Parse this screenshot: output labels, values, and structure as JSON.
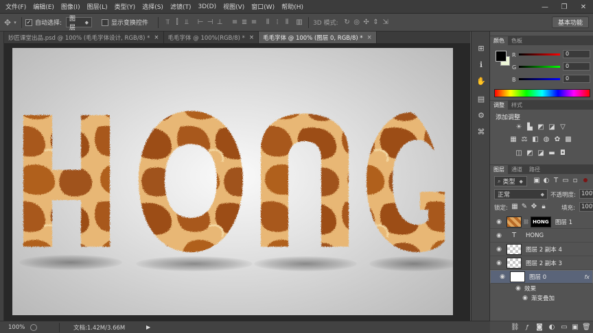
{
  "menu": [
    "文件(F)",
    "编辑(E)",
    "图像(I)",
    "图层(L)",
    "类型(Y)",
    "选择(S)",
    "滤镜(T)",
    "3D(D)",
    "视图(V)",
    "窗口(W)",
    "帮助(H)"
  ],
  "window_controls": {
    "minimize": "—",
    "restore": "❐",
    "close": "✕"
  },
  "options": {
    "auto_select_label": "自动选择:",
    "auto_select_value": "图层",
    "show_transform_label": "显示变换控件",
    "mode_3d_label": "3D 模式:",
    "workspace_button": "基本功能"
  },
  "tabs": [
    {
      "label": "妙匠课堂出品.psd @ 100% (毛毛字体设计, RGB/8) *",
      "close": "×",
      "active": false
    },
    {
      "label": "毛毛字体 @ 100%(RGB/8) *",
      "close": "×",
      "active": false
    },
    {
      "label": "毛毛字体 @ 100% (图层 0, RGB/8) *",
      "close": "×",
      "active": true
    }
  ],
  "canvas": {
    "letters": [
      "H",
      "O",
      "N",
      "G"
    ]
  },
  "status": {
    "zoom": "100%",
    "doc_info": "文档:1.42M/3.66M"
  },
  "color_panel": {
    "tabs": [
      "颜色",
      "色板"
    ],
    "channels": [
      {
        "label": "R",
        "value": "0",
        "color": "#d02020"
      },
      {
        "label": "G",
        "value": "0",
        "color": "#20b020"
      },
      {
        "label": "B",
        "value": "0",
        "color": "#2030d0"
      }
    ]
  },
  "adjust_panel": {
    "tabs": [
      "调整",
      "样式"
    ],
    "title": "添加调整"
  },
  "layers_panel": {
    "tabs": [
      "图层",
      "通道",
      "路径"
    ],
    "filter": "类型",
    "blend_mode": "正常",
    "opacity_label": "不透明度:",
    "opacity_value": "100%",
    "lock_label": "锁定:",
    "fill_label": "填充:",
    "fill_value": "100%",
    "layers": [
      {
        "name": "图层 1",
        "mask_text": "HONG",
        "selected": false
      },
      {
        "name": "HONG",
        "type": "text",
        "selected": false
      },
      {
        "name": "图层 2 副本 4",
        "selected": false
      },
      {
        "name": "图层 2 副本 3",
        "selected": false
      },
      {
        "name": "图层 0",
        "fx": "fx",
        "selected": true
      }
    ],
    "effects_label": "效果",
    "effect_item": "渐变叠加"
  }
}
